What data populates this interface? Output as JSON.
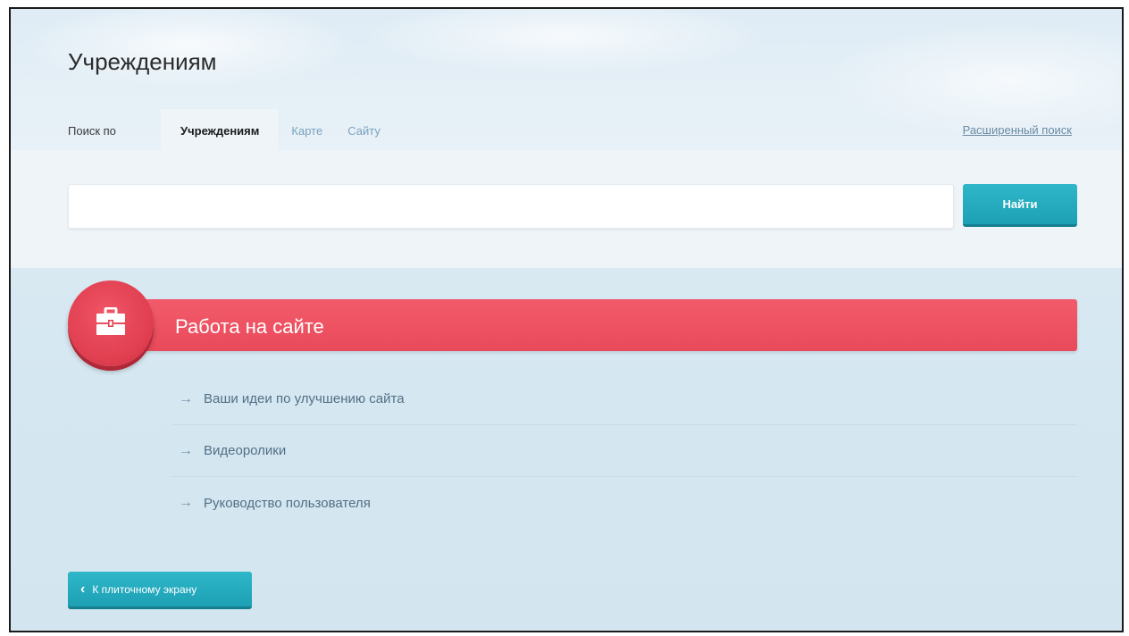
{
  "page": {
    "title": "Учреждениям"
  },
  "tabs": {
    "prefix": "Поиск по",
    "items": [
      {
        "label": "Учреждениям",
        "active": true
      },
      {
        "label": "Карте",
        "active": false
      },
      {
        "label": "Сайту",
        "active": false
      }
    ]
  },
  "advanced_search": "Расширенный поиск",
  "search": {
    "value": "",
    "button_label": "Найти"
  },
  "section": {
    "title": "Работа на сайте",
    "icon": "briefcase-icon",
    "accent_color": "#e94a5b",
    "links": [
      "Ваши идеи по улучшению сайта",
      "Видеоролики",
      "Руководство пользователя"
    ]
  },
  "back_button": {
    "label": "К плиточному экрану"
  },
  "colors": {
    "primary_button": "#1da0b4",
    "link": "#526f86"
  }
}
